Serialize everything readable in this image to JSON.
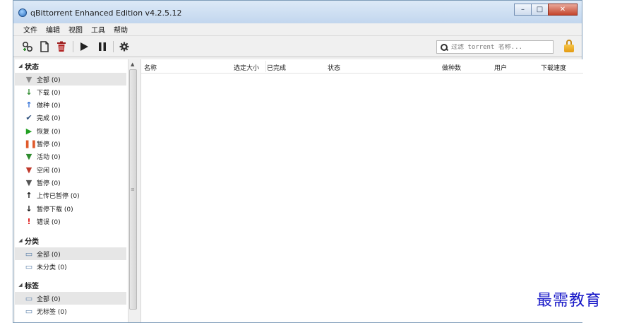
{
  "window": {
    "title": "qBittorrent Enhanced Edition v4.2.5.12",
    "controls": {
      "minimize": "–",
      "maximize": "□",
      "close": "✕"
    }
  },
  "menu": [
    "文件",
    "编辑",
    "视图",
    "工具",
    "帮助"
  ],
  "toolbar": {
    "icons": [
      "add-torrent-link-icon",
      "add-torrent-file-icon",
      "delete-icon",
      "resume-icon",
      "pause-icon",
      "options-gear-icon",
      "lock-icon"
    ],
    "search_placeholder": "过滤 torrent 名称..."
  },
  "sidebar": {
    "status": {
      "title": "状态",
      "items": [
        {
          "label": "全部 (0)",
          "icon": "filter-funnel-icon",
          "color": "#8a8a8a",
          "glyph": "▼"
        },
        {
          "label": "下载 (0)",
          "icon": "download-arrow-icon",
          "color": "#2e8b2e",
          "glyph": "↓"
        },
        {
          "label": "做种 (0)",
          "icon": "upload-arrow-icon",
          "color": "#2f6fd6",
          "glyph": "↑"
        },
        {
          "label": "完成 (0)",
          "icon": "checkmark-icon",
          "color": "#2c4f7c",
          "glyph": "✔"
        },
        {
          "label": "恢复 (0)",
          "icon": "play-icon",
          "color": "#22a022",
          "glyph": "▶"
        },
        {
          "label": "暂停 (0)",
          "icon": "pause-icon",
          "color": "#e05a2b",
          "glyph": "❚❚"
        },
        {
          "label": "活动 (0)",
          "icon": "active-funnel-icon",
          "color": "#2e8b2e",
          "glyph": "▼"
        },
        {
          "label": "空闲 (0)",
          "icon": "inactive-funnel-icon",
          "color": "#c0392b",
          "glyph": "▼"
        },
        {
          "label": "暂停 (0)",
          "icon": "stalled-funnel-icon",
          "color": "#555555",
          "glyph": "▼"
        },
        {
          "label": "上传已暂停 (0)",
          "icon": "stalled-upload-icon",
          "color": "#111111",
          "glyph": "↑"
        },
        {
          "label": "暂停下载 (0)",
          "icon": "stalled-download-icon",
          "color": "#111111",
          "glyph": "↓"
        },
        {
          "label": "错误 (0)",
          "icon": "error-exclamation-icon",
          "color": "#e02020",
          "glyph": "!"
        }
      ]
    },
    "categories": {
      "title": "分类",
      "items": [
        {
          "label": "全部 (0)",
          "icon": "folder-icon"
        },
        {
          "label": "未分类 (0)",
          "icon": "folder-icon"
        }
      ]
    },
    "tags": {
      "title": "标签",
      "items": [
        {
          "label": "全部 (0)",
          "icon": "folder-icon"
        },
        {
          "label": "无标签 (0)",
          "icon": "folder-icon"
        }
      ]
    }
  },
  "list": {
    "columns": [
      "名称",
      "选定大小",
      "已完成",
      "状态",
      "做种数",
      "用户",
      "下载速度"
    ],
    "rows": []
  },
  "watermark": "最需教育"
}
